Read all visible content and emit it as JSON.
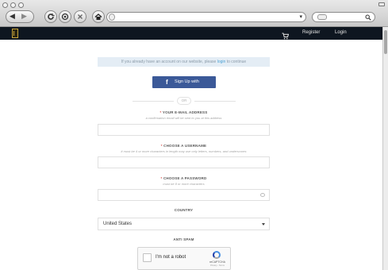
{
  "browser": {
    "nav_back": "◀",
    "nav_forward": "▶",
    "url_value": "",
    "url_dropdown_arrow": "▾",
    "search_value": "",
    "search_icon": "search-icon"
  },
  "header": {
    "cart_icon": "cart-icon",
    "register": "Register",
    "login": "Login"
  },
  "form": {
    "notice_text": "If you already have an account on our website, please ",
    "notice_link": "login",
    "notice_suffix": " to continue",
    "facebook_button": "Sign Up with Facebook",
    "or_label": "OR",
    "email_label": "YOUR E-MAIL ADDRESS",
    "email_hint": "a confirmation email will be sent to you at this address",
    "username_label": "CHOOSE A USERNAME",
    "username_hint": "it must be 4 or more characters in length may use only letters, numbers, and underscores",
    "password_label": "CHOOSE A PASSWORD",
    "password_hint": "must be 8 or more characters",
    "country_label": "COUNTRY",
    "country_value": "United States",
    "antispam_label": "ANTI SPAM",
    "recaptcha_text": "I'm not a robot",
    "recaptcha_brand": "reCAPTCHA",
    "recaptcha_terms": "Privacy - Terms"
  },
  "colors": {
    "header_bg": "#0e1620",
    "facebook_blue": "#3b5998",
    "notice_bg": "#e4edf5",
    "link_blue": "#4ea3d6",
    "required_red": "#d9534f"
  }
}
